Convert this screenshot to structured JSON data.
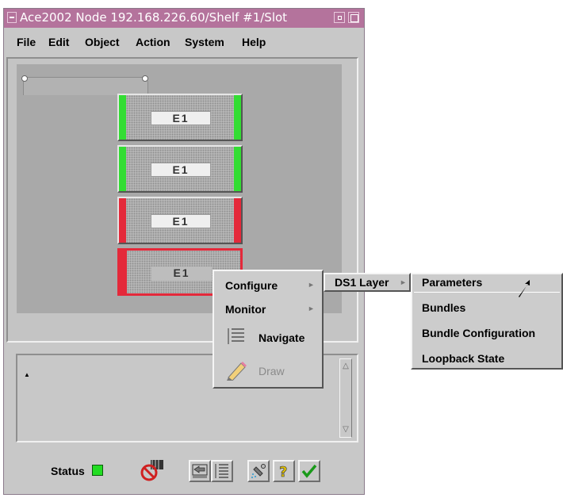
{
  "window": {
    "title": "Ace2002 Node 192.168.226.60/Shelf #1/Slot",
    "title_color": "#b4739c"
  },
  "menubar": {
    "items": [
      "File",
      "Edit",
      "Object",
      "Action",
      "System",
      "Help"
    ]
  },
  "shelf": {
    "cards": [
      {
        "label": "E1",
        "status_color": "#33dd33"
      },
      {
        "label": "E1",
        "status_color": "#33dd33"
      },
      {
        "label": "E1",
        "status_color": "#e4293a"
      },
      {
        "label": "E1",
        "status_color": "#e4293a",
        "selected": true
      }
    ]
  },
  "context_menu": {
    "items": [
      {
        "label": "Configure",
        "has_submenu": true
      },
      {
        "label": "Monitor",
        "has_submenu": true
      },
      {
        "label": "Navigate",
        "icon": "navigate-list-icon"
      },
      {
        "label": "Draw",
        "icon": "pencil-icon",
        "disabled": true
      }
    ]
  },
  "submenu_configure": {
    "items": [
      {
        "label": "DS1 Layer",
        "has_submenu": true
      }
    ]
  },
  "submenu_ds1": {
    "items": [
      {
        "label": "Parameters",
        "highlighted": true
      },
      {
        "label": "Bundles"
      },
      {
        "label": "Bundle Configuration"
      },
      {
        "label": "Loopback State"
      }
    ]
  },
  "toolbar": {
    "status_label": "Status",
    "status_color": "#22dd22",
    "buttons": [
      "no-entry-icon",
      "back-arrow-icon",
      "list-icon",
      "spray-icon",
      "help-icon",
      "check-icon"
    ]
  }
}
